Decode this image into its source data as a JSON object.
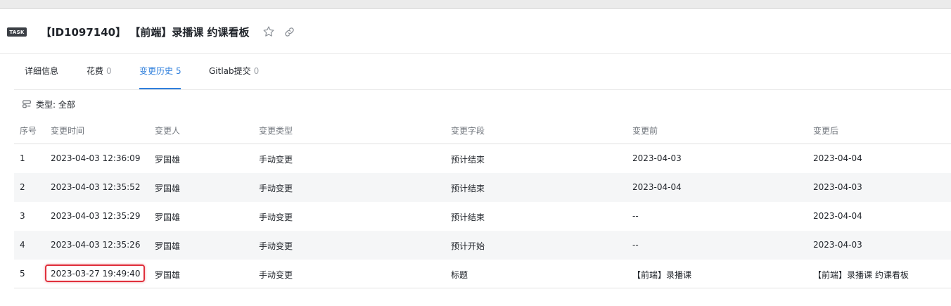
{
  "header": {
    "badge": "TASK",
    "title": "【ID1097140】 【前端】录播课 约课看板"
  },
  "tabs": [
    {
      "label": "详细信息",
      "count": ""
    },
    {
      "label": "花费",
      "count": "0"
    },
    {
      "label": "变更历史",
      "count": "5"
    },
    {
      "label": "Gitlab提交",
      "count": "0"
    }
  ],
  "filter": {
    "label": "类型: 全部"
  },
  "table": {
    "headers": [
      "序号",
      "变更时间",
      "变更人",
      "变更类型",
      "变更字段",
      "变更前",
      "变更后"
    ],
    "rows": [
      [
        "1",
        "2023-04-03 12:36:09",
        "罗国雄",
        "手动变更",
        "预计结束",
        "2023-04-03",
        "2023-04-04"
      ],
      [
        "2",
        "2023-04-03 12:35:52",
        "罗国雄",
        "手动变更",
        "预计结束",
        "2023-04-04",
        "2023-04-03"
      ],
      [
        "3",
        "2023-04-03 12:35:29",
        "罗国雄",
        "手动变更",
        "预计结束",
        "--",
        "2023-04-04"
      ],
      [
        "4",
        "2023-04-03 12:35:26",
        "罗国雄",
        "手动变更",
        "预计开始",
        "--",
        "2023-04-03"
      ],
      [
        "5",
        "2023-03-27 19:49:40",
        "罗国雄",
        "手动变更",
        "标题",
        "【前端】录播课",
        "【前端】录播课 约课看板"
      ]
    ]
  },
  "colors": {
    "accent": "#2f7fdc",
    "highlight": "#e0303c"
  }
}
